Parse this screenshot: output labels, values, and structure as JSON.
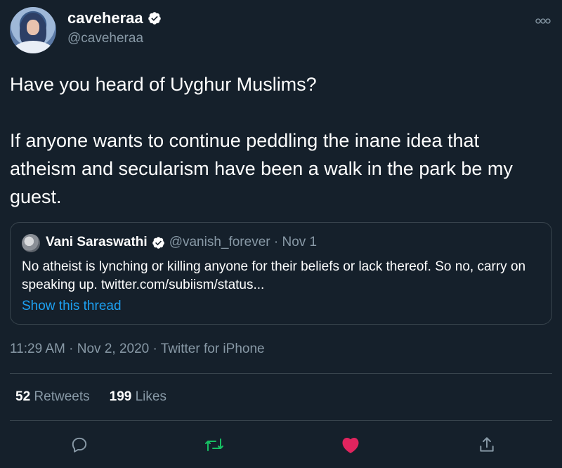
{
  "author": {
    "display_name": "caveheraa",
    "handle": "@caveheraa",
    "verified": true
  },
  "tweet": {
    "text": "Have you heard of Uyghur Muslims?\n\nIf anyone wants to continue peddling the inane idea that atheism and secularism have been a walk in the park be my guest."
  },
  "quoted_tweet": {
    "display_name": "Vani Saraswathi",
    "verified": true,
    "handle_and_date": "@vanish_forever · Nov 1",
    "text": "No atheist is lynching or killing anyone for their beliefs or lack thereof. So no, carry on speaking up. twitter.com/subiism/status...",
    "show_thread_label": "Show this thread"
  },
  "meta": {
    "timestamp": "11:29 AM · Nov 2, 2020 · Twitter for iPhone"
  },
  "stats": {
    "retweets_count": "52",
    "retweets_label": "Retweets",
    "likes_count": "199",
    "likes_label": "Likes"
  },
  "icons": {
    "more": "more-options-icon",
    "reply": "reply-icon",
    "retweet": "retweet-icon",
    "like": "like-icon",
    "share": "share-icon",
    "verified": "verified-badge-icon"
  },
  "colors": {
    "background": "#15202b",
    "text_primary": "#ffffff",
    "text_secondary": "#8899a6",
    "link": "#1da1f2",
    "retweet_active": "#17bf63",
    "like_active": "#e0245e",
    "border": "#38444d"
  }
}
